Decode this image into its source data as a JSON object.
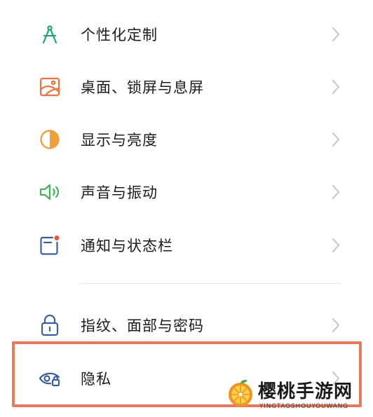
{
  "settings": {
    "items": [
      {
        "label": "个性化定制",
        "icon": "compass-icon",
        "color": "#1fa67a"
      },
      {
        "label": "桌面、锁屏与息屏",
        "icon": "wallpaper-icon",
        "color": "#e8773f"
      },
      {
        "label": "显示与亮度",
        "icon": "brightness-icon",
        "color": "#f0a03a"
      },
      {
        "label": "声音与振动",
        "icon": "speaker-icon",
        "color": "#3fb55a"
      },
      {
        "label": "通知与状态栏",
        "icon": "notification-icon",
        "color": "#3a5f9e"
      },
      {
        "label": "指纹、面部与密码",
        "icon": "lock-icon",
        "color": "#3a5f9e"
      },
      {
        "label": "隐私",
        "icon": "privacy-eye-icon",
        "color": "#3a5f9e"
      }
    ]
  },
  "highlight_color": "#e8795a",
  "watermark": {
    "title": "樱桃手游网",
    "subtitle": "YINGTAOSHOUYOUWANG"
  }
}
